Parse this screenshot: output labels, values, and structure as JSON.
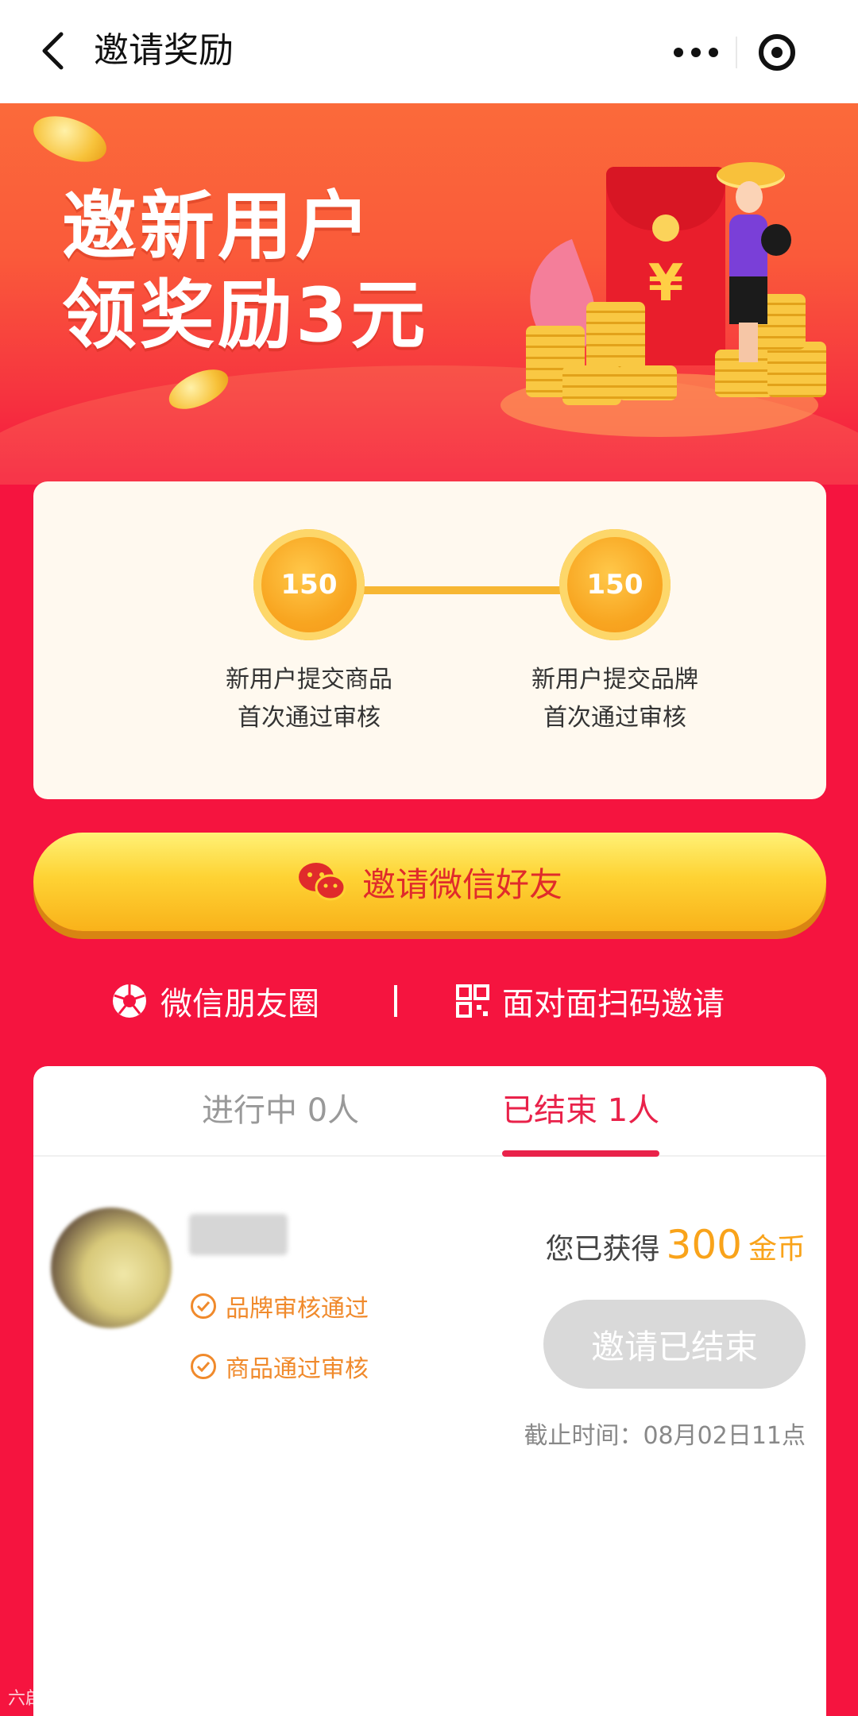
{
  "nav": {
    "title": "邀请奖励"
  },
  "banner": {
    "line1": "邀新用户",
    "line2": "领奖励3元",
    "envelope_symbol": "¥"
  },
  "reward_steps": [
    {
      "coins": "150",
      "line1": "新用户提交商品",
      "line2": "首次通过审核"
    },
    {
      "coins": "150",
      "line1": "新用户提交品牌",
      "line2": "首次通过审核"
    }
  ],
  "invite_button": {
    "label": "邀请微信好友"
  },
  "share": {
    "moments_label": "微信朋友圈",
    "scan_label": "面对面扫码邀请"
  },
  "tabs": [
    {
      "label": "进行中 0人",
      "active": false
    },
    {
      "label": "已结束 1人",
      "active": true
    }
  ],
  "record": {
    "statuses": [
      "品牌审核通过",
      "商品通过审核"
    ],
    "earned_prefix": "您已获得",
    "earned_amount": "300",
    "earned_unit": "金币",
    "button_label": "邀请已结束",
    "deadline": "截止时间：08月02日11点"
  },
  "watermark": "六啟跨境",
  "colors": {
    "page_bg": "#f5143f",
    "accent_red": "#e9224a",
    "gold": "#f9a31a",
    "status_orange": "#f08a2c",
    "button_gold": "#fed334"
  },
  "icons": [
    "back-chevron-icon",
    "more-dots-icon",
    "close-target-icon",
    "wechat-icon",
    "moments-shutter-icon",
    "qr-code-icon",
    "check-circle-icon"
  ]
}
